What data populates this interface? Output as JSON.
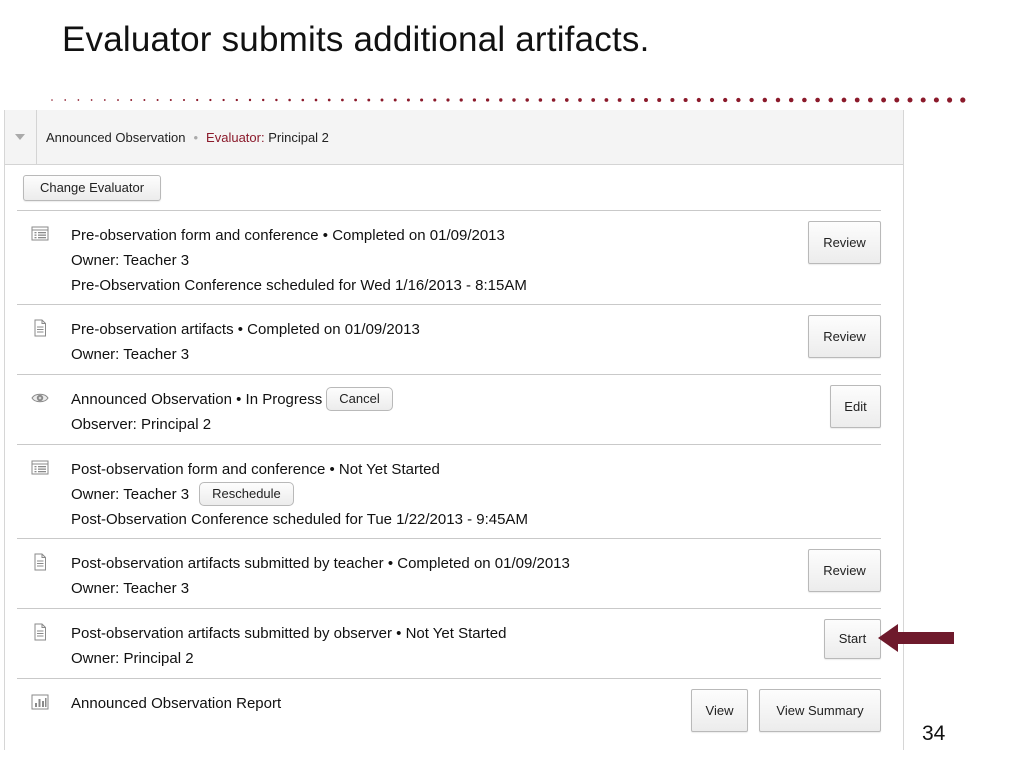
{
  "slide": {
    "title": "Evaluator submits additional artifacts.",
    "page_number": "34"
  },
  "header": {
    "observation_name": "Announced Observation",
    "evaluator_label": "Evaluator:",
    "evaluator_name": "Principal 2"
  },
  "change_evaluator_label": "Change Evaluator",
  "rows": [
    {
      "icon": "form-list-icon",
      "title": "Pre-observation form and conference • Completed on 01/09/2013",
      "owner": "Owner: Teacher 3",
      "extra": "Pre-Observation Conference scheduled for Wed 1/16/2013 - 8:15AM",
      "action": "Review"
    },
    {
      "icon": "document-icon",
      "title": "Pre-observation artifacts • Completed on 01/09/2013",
      "owner": "Owner: Teacher 3",
      "action": "Review"
    },
    {
      "icon": "eye-icon",
      "title": "Announced Observation • In Progress",
      "inline_button": "Cancel",
      "owner": "Observer: Principal 2",
      "action": "Edit"
    },
    {
      "icon": "form-list-icon",
      "title": "Post-observation form and conference • Not Yet Started",
      "owner": "Owner: Teacher 3",
      "inline_button": "Reschedule",
      "extra": "Post-Observation Conference scheduled for Tue 1/22/2013 - 9:45AM"
    },
    {
      "icon": "document-icon",
      "title": "Post-observation artifacts submitted by teacher • Completed on 01/09/2013",
      "owner": "Owner: Teacher 3",
      "action": "Review"
    },
    {
      "icon": "document-icon",
      "title": "Post-observation artifacts submitted by observer • Not Yet Started",
      "owner": "Owner: Principal 2",
      "action": "Start"
    },
    {
      "icon": "bar-chart-icon",
      "title": "Announced Observation Report",
      "actions": [
        "View",
        "View Summary"
      ]
    }
  ],
  "colors": {
    "accent": "#8b1a2b",
    "arrow": "#6e1a2c",
    "divider": "#c9c9c9"
  }
}
